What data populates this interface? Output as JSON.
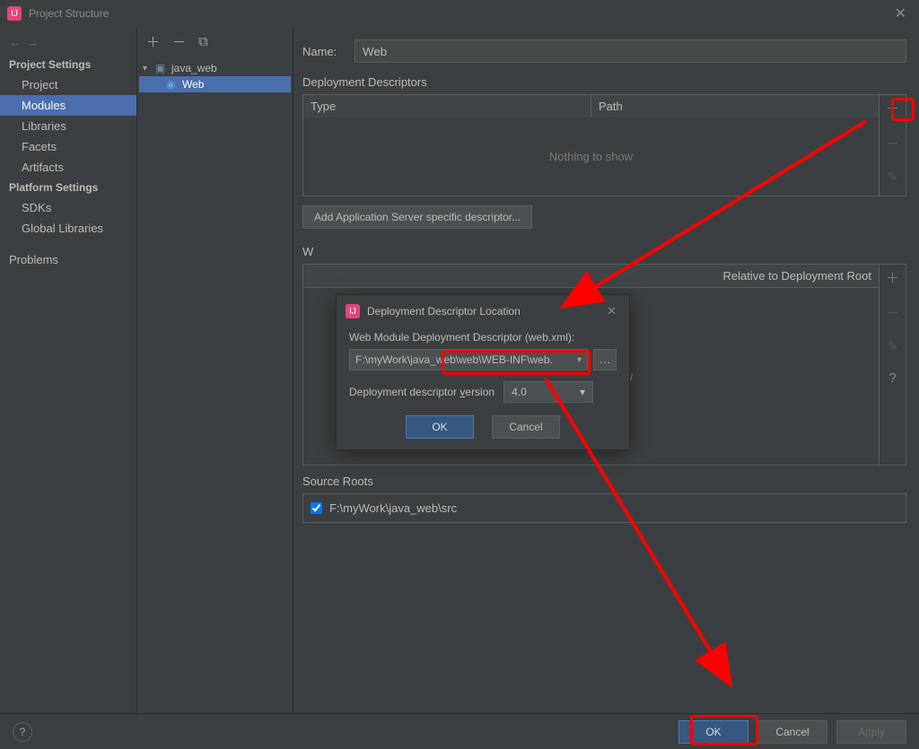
{
  "window": {
    "title": "Project Structure"
  },
  "sidebar": {
    "groups": [
      {
        "heading": "Project Settings",
        "items": [
          "Project",
          "Modules",
          "Libraries",
          "Facets",
          "Artifacts"
        ],
        "selected": "Modules"
      },
      {
        "heading": "Platform Settings",
        "items": [
          "SDKs",
          "Global Libraries"
        ]
      },
      {
        "heading": "",
        "items": [
          "Problems"
        ]
      }
    ]
  },
  "tree": {
    "root": {
      "label": "java_web"
    },
    "child": {
      "label": "Web"
    }
  },
  "main": {
    "name_label": "Name:",
    "name_value": "Web",
    "dd_title": "Deployment Descriptors",
    "col_type": "Type",
    "col_path": "Path",
    "nothing": "Nothing to show",
    "add_server_btn": "Add Application Server specific descriptor...",
    "w_prefix": "W",
    "relative_header": "Relative to Deployment Root",
    "source_roots": "Source Roots",
    "src_path": "F:\\myWork\\java_web\\src"
  },
  "modal": {
    "title": "Deployment Descriptor Location",
    "field_label": "Web Module Deployment Descriptor (web.xml):",
    "path": "F:\\myWork\\java_web\\web\\WEB-INF\\web.",
    "version_label_pre": "Deployment descriptor ",
    "version_hot": "v",
    "version_label_post": "ersion",
    "version": "4.0",
    "ok": "OK",
    "cancel": "Cancel"
  },
  "bottom": {
    "ok": "OK",
    "cancel": "Cancel",
    "apply": "Apply"
  }
}
